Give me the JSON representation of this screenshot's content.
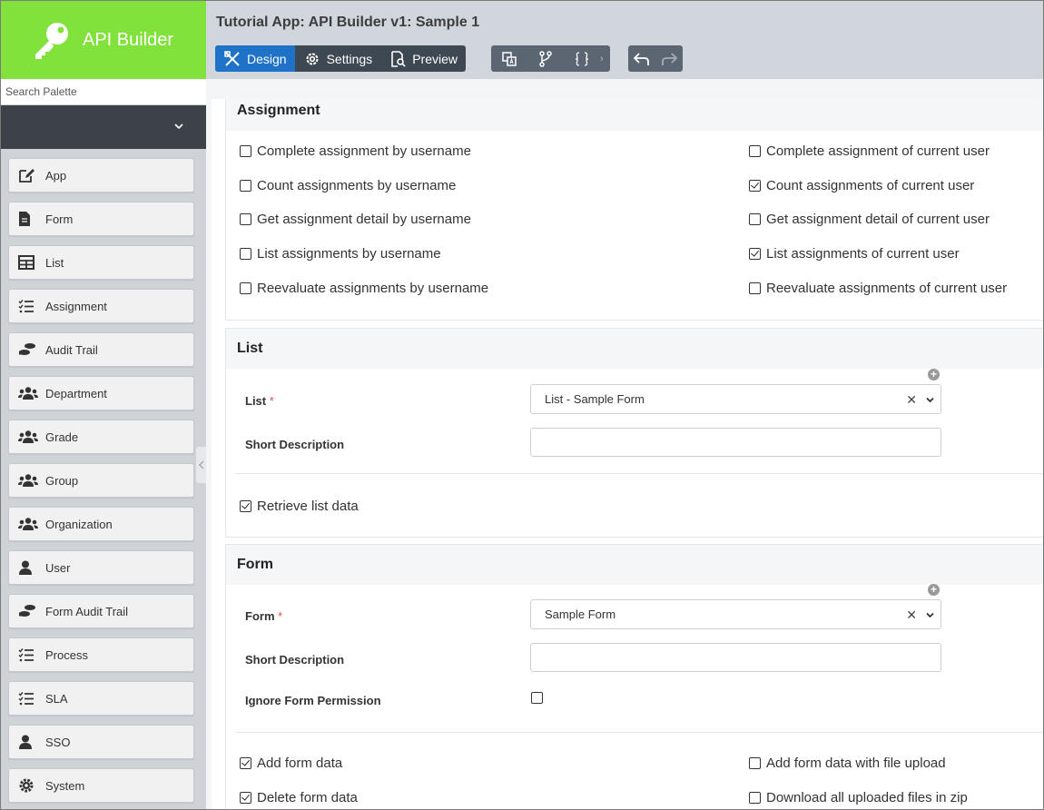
{
  "brand": {
    "title": "API Builder"
  },
  "search": {
    "placeholder": "Search Palette"
  },
  "palette": [
    {
      "label": "App",
      "icon": "edit-icon"
    },
    {
      "label": "Form",
      "icon": "file-icon"
    },
    {
      "label": "List",
      "icon": "table-icon"
    },
    {
      "label": "Assignment",
      "icon": "tasks-icon"
    },
    {
      "label": "Audit Trail",
      "icon": "footsteps-icon"
    },
    {
      "label": "Department",
      "icon": "users-icon"
    },
    {
      "label": "Grade",
      "icon": "users-icon"
    },
    {
      "label": "Group",
      "icon": "users-icon"
    },
    {
      "label": "Organization",
      "icon": "users-icon"
    },
    {
      "label": "User",
      "icon": "user-icon"
    },
    {
      "label": "Form Audit Trail",
      "icon": "footsteps-icon"
    },
    {
      "label": "Process",
      "icon": "tasks-icon"
    },
    {
      "label": "SLA",
      "icon": "tasks-icon"
    },
    {
      "label": "SSO",
      "icon": "user-icon"
    },
    {
      "label": "System",
      "icon": "gear-icon"
    }
  ],
  "header": {
    "title": "Tutorial App: API Builder v1: Sample 1",
    "tabs": {
      "design": "Design",
      "settings": "Settings",
      "preview": "Preview"
    }
  },
  "assignment": {
    "title": "Assignment",
    "left": [
      {
        "label": "Complete assignment by username",
        "checked": false
      },
      {
        "label": "Count assignments by username",
        "checked": false
      },
      {
        "label": "Get assignment detail by username",
        "checked": false
      },
      {
        "label": "List assignments by username",
        "checked": false
      },
      {
        "label": "Reevaluate assignments by username",
        "checked": false
      }
    ],
    "right": [
      {
        "label": "Complete assignment of current user",
        "checked": false
      },
      {
        "label": "Count assignments of current user",
        "checked": true
      },
      {
        "label": "Get assignment detail of current user",
        "checked": false
      },
      {
        "label": "List assignments of current user",
        "checked": true
      },
      {
        "label": "Reevaluate assignments of current user",
        "checked": false
      }
    ]
  },
  "list": {
    "title": "List",
    "list_label": "List",
    "required_mark": "*",
    "list_value": "List - Sample Form",
    "short_desc_label": "Short Description",
    "short_desc_value": "",
    "retrieve_label": "Retrieve list data",
    "retrieve_checked": true
  },
  "form": {
    "title": "Form",
    "form_label": "Form",
    "required_mark": "*",
    "form_value": "Sample Form",
    "short_desc_label": "Short Description",
    "short_desc_value": "",
    "ignore_label": "Ignore Form Permission",
    "ignore_checked": false,
    "left": [
      {
        "label": "Add form data",
        "checked": true
      },
      {
        "label": "Delete form data",
        "checked": true
      }
    ],
    "right": [
      {
        "label": "Add form data with file upload",
        "checked": false
      },
      {
        "label": "Download all uploaded files in zip",
        "checked": false
      }
    ]
  },
  "colors": {
    "brand_green": "#80e23b",
    "active_tab": "#1e73c9",
    "toolbar_dark": "#3e4852",
    "sidebar_dark": "#3c4247"
  }
}
